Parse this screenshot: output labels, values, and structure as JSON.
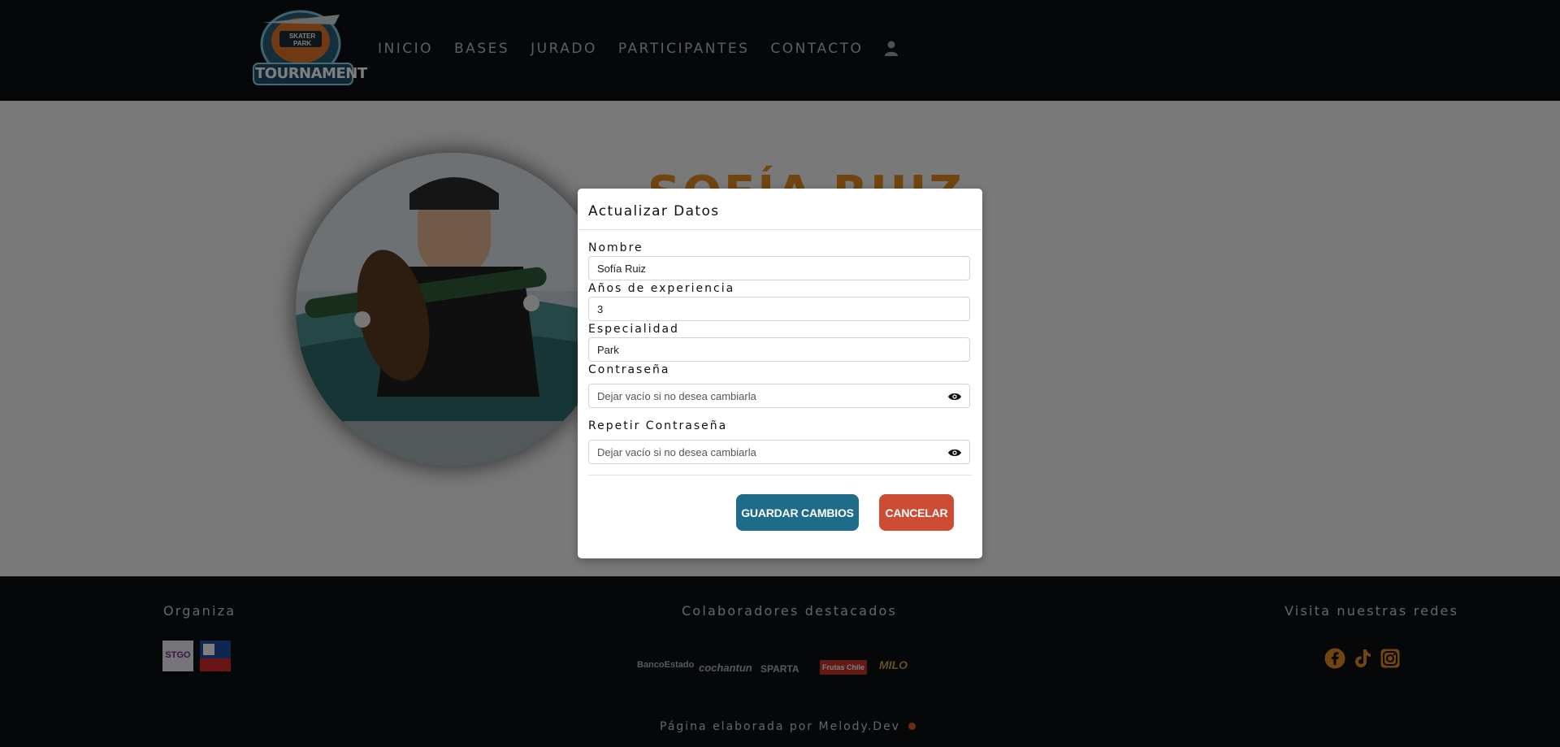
{
  "header": {
    "logo_text": "TOURNAMENT",
    "logo_subtext": "SKATER PARK",
    "nav": [
      "INICIO",
      "BASES",
      "JURADO",
      "PARTICIPANTES",
      "CONTACTO"
    ]
  },
  "profile": {
    "name": "SOFÍA RUIZ"
  },
  "modal": {
    "title": "Actualizar Datos",
    "fields": {
      "nombre": {
        "label": "Nombre",
        "value": "Sofía Ruiz"
      },
      "experiencia": {
        "label": "Años de experiencia",
        "value": "3"
      },
      "especialidad": {
        "label": "Especialidad",
        "value": "Park"
      },
      "password": {
        "label": "Contraseña",
        "placeholder": "Dejar vacío si no desea cambiarla"
      },
      "password_repeat": {
        "label": "Repetir Contraseña",
        "placeholder": "Dejar vacío si no desea cambiarla"
      }
    },
    "save_label": "GUARDAR CAMBIOS",
    "cancel_label": "CANCELAR"
  },
  "footer": {
    "organiza": "Organiza",
    "colaboradores": "Colaboradores destacados",
    "redes": "Visita nuestras redes",
    "org_logo_1": "STGO",
    "sponsors": [
      "BancoEstado",
      "cochantun",
      "SPARTA",
      "Frutas Chile",
      "MILO"
    ],
    "credit": "Página elaborada por Melody.Dev"
  },
  "colors": {
    "header_bg": "#0b0f12",
    "accent": "#e08b1e",
    "save_button": "#1e6b8a",
    "cancel_button": "#cc4d33"
  },
  "icons": [
    "user-icon",
    "eye-icon",
    "facebook-icon",
    "tiktok-icon",
    "instagram-icon"
  ]
}
